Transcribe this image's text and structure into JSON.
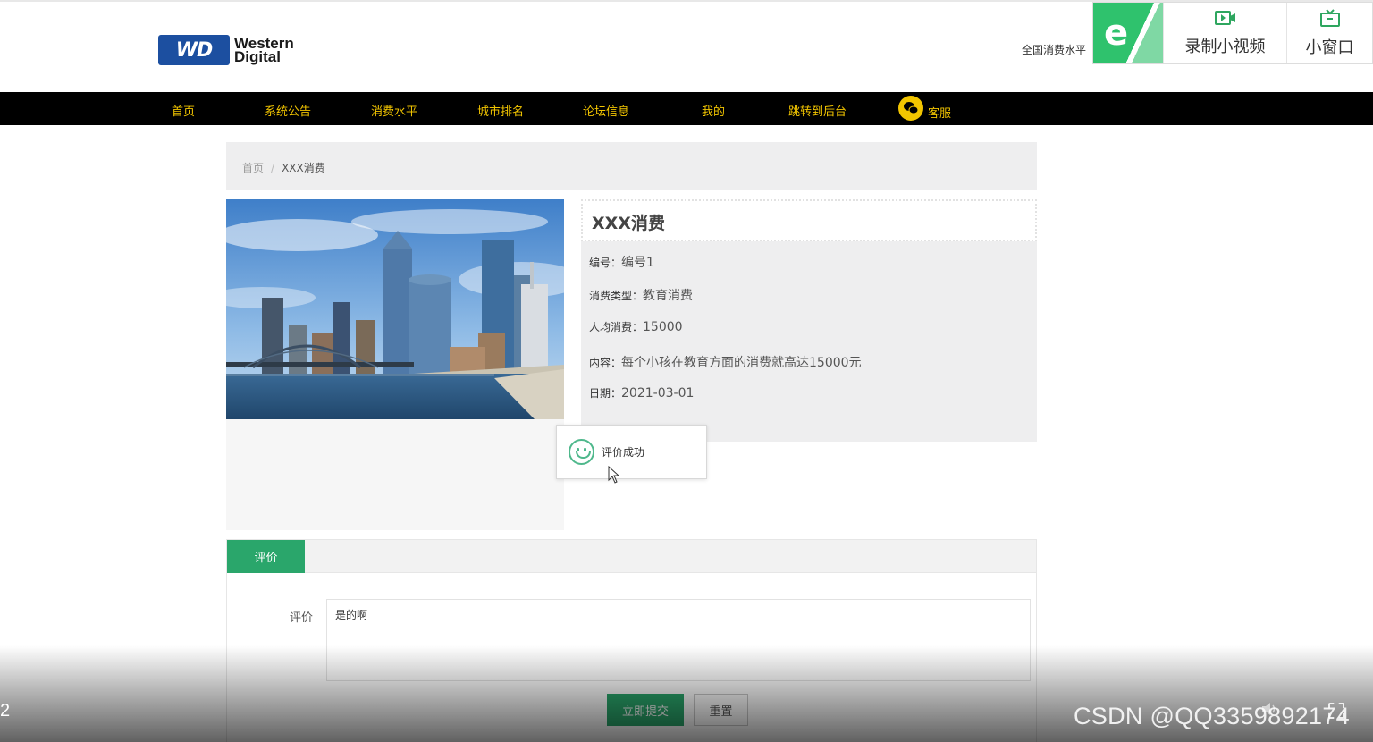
{
  "header": {
    "logo": {
      "mark": "WD",
      "line1": "Western",
      "line2": "Digital"
    },
    "top_link": "全国消费水平"
  },
  "recorder": {
    "e_icon": "e",
    "record_label": "录制小视频",
    "window_label": "小窗口"
  },
  "nav": {
    "items": [
      "首页",
      "系统公告",
      "消费水平",
      "城市排名",
      "论坛信息",
      "我的",
      "跳转到后台"
    ],
    "service": "客服"
  },
  "breadcrumb": {
    "home": "首页",
    "separator": "/",
    "current": "XXX消费"
  },
  "detail": {
    "title": "XXX消费",
    "rows": [
      {
        "label": "编号：",
        "value": "编号1"
      },
      {
        "label": "消费类型：",
        "value": "教育消费"
      },
      {
        "label": "人均消费：",
        "value": "15000"
      },
      {
        "label": "内容：",
        "value": "每个小孩在教育方面的消费就高达15000元"
      },
      {
        "label": "日期：",
        "value": "2021-03-01"
      }
    ]
  },
  "toast": {
    "message": "评价成功"
  },
  "comment": {
    "tab": "评价",
    "label": "评价",
    "value": "是的啊",
    "submit": "立即提交",
    "reset": "重置"
  },
  "video": {
    "counter": "2",
    "watermark": "CSDN @QQ3359892174"
  },
  "colors": {
    "nav_bg": "#000000",
    "nav_text": "#f2c500",
    "accent_green": "#2aa66b",
    "panel_bg": "#eeeeef"
  }
}
